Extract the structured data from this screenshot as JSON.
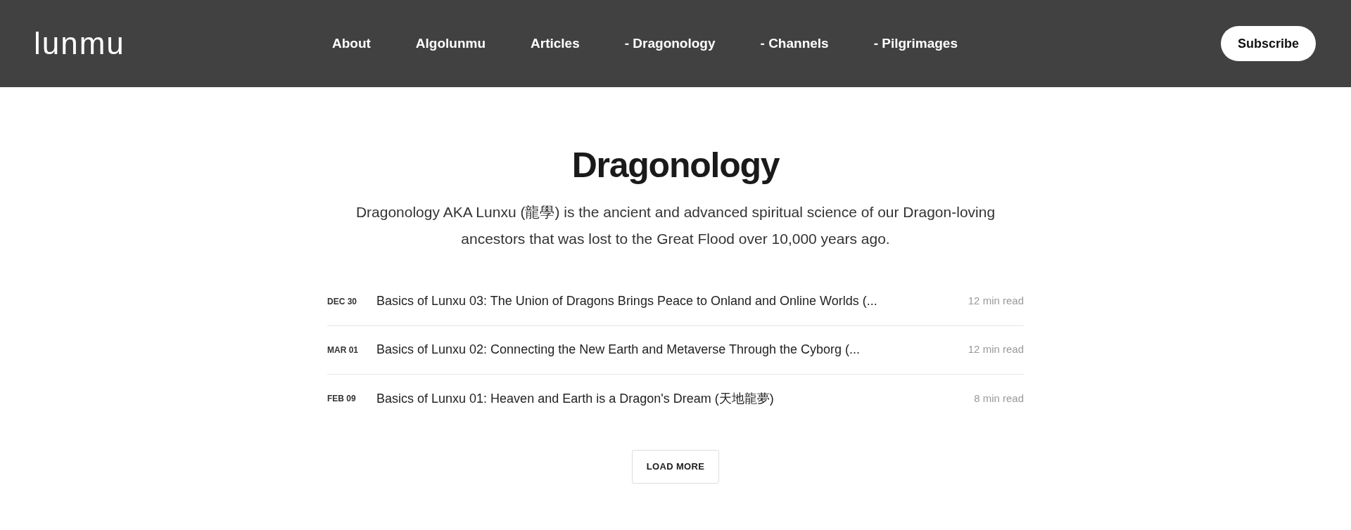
{
  "header": {
    "logo": "lunmu",
    "nav": [
      {
        "label": "About"
      },
      {
        "label": "Algolunmu"
      },
      {
        "label": "Articles"
      },
      {
        "label": "- Dragonology"
      },
      {
        "label": "- Channels"
      },
      {
        "label": "- Pilgrimages"
      }
    ],
    "subscribe": "Subscribe"
  },
  "page": {
    "title": "Dragonology",
    "description": "Dragonology AKA Lunxu (龍學) is the ancient and advanced spiritual science of our Dragon-loving ancestors that was lost to the Great Flood over 10,000 years ago."
  },
  "posts": [
    {
      "date": "DEC 30",
      "title": "Basics of Lunxu 03: The Union of Dragons Brings Peace to Onland and Online Worlds (...",
      "read_time": "12 min read"
    },
    {
      "date": "MAR 01",
      "title": "Basics of Lunxu 02: Connecting the New Earth and Metaverse Through the Cyborg (...",
      "read_time": "12 min read"
    },
    {
      "date": "FEB 09",
      "title": "Basics of Lunxu 01: Heaven and Earth is a Dragon's Dream (天地龍夢)",
      "read_time": "8 min read"
    }
  ],
  "load_more": "LOAD MORE"
}
